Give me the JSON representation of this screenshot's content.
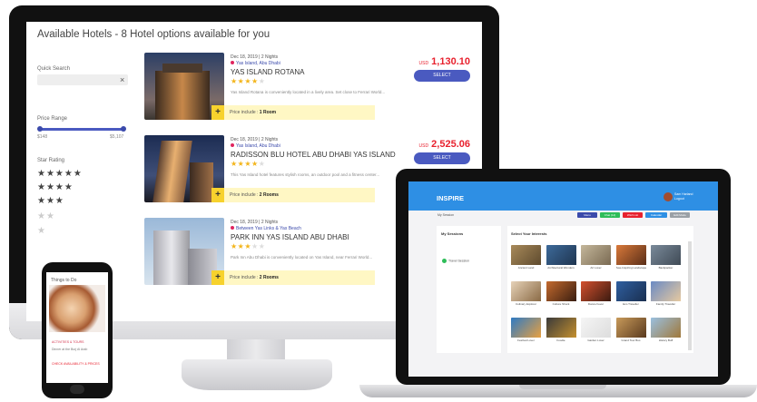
{
  "hotel_site": {
    "header": "Available Hotels - 8 Hotel options available for you",
    "filters": {
      "quick_search_label": "Quick Search",
      "clear_glyph": "×",
      "price_range_label": "Price Range",
      "price_min": "$148",
      "price_max": "$5,107",
      "star_rating_label": "Star Rating",
      "star_rows": [
        "★★★★★",
        "★★★★",
        "★★★",
        "★★",
        "★"
      ]
    },
    "hotels": [
      {
        "date": "Dec 18, 2019 | 2 Nights",
        "location": "Yas Island, Abu Dhabi",
        "name": "YAS ISLAND ROTANA",
        "stars": 4,
        "description": "Yas Island Rotana is conveniently located in a lively area. Set close to Ferrari World...",
        "price_currency": "USD",
        "price": "1,130.10",
        "select_label": "SELECT",
        "rooms_label": "Price include : ",
        "rooms_value": "1 Room",
        "plus_glyph": "+"
      },
      {
        "date": "Dec 18, 2019 | 2 Nights",
        "location": "Yas Island, Abu Dhabi",
        "name": "RADISSON BLU HOTEL ABU DHABI YAS ISLAND",
        "stars": 4,
        "description": "This Yas Island hotel features stylish rooms, an outdoor pool and a fitness center...",
        "price_currency": "USD",
        "price": "2,525.06",
        "select_label": "SELECT",
        "rooms_label": "Price include : ",
        "rooms_value": "2 Rooms",
        "plus_glyph": "+"
      },
      {
        "date": "Dec 18, 2019 | 2 Nights",
        "location": "Between Yas Links & Yas Beach",
        "name": "PARK INN YAS ISLAND ABU DHABI",
        "stars": 3,
        "description": "Park Inn Abu Dhabi is conveniently located on Yas Island, near Ferrari World...",
        "price_currency": "",
        "price": "",
        "select_label": "",
        "rooms_label": "Price include : ",
        "rooms_value": "2 Rooms",
        "plus_glyph": "+"
      }
    ]
  },
  "inspire_app": {
    "brand": "INSPIRE",
    "user_line1": "Sam Harland",
    "user_line2": "Logout",
    "breadcrumb": "My Session",
    "toolbar": [
      {
        "label": "Menu",
        "color": "#3b4aab"
      },
      {
        "label": "Chat (12)",
        "color": "#2ebd59"
      },
      {
        "label": "Wish List",
        "color": "#e8212e"
      },
      {
        "label": "Calendar",
        "color": "#2e8fe4"
      },
      {
        "label": "Edit Mode",
        "color": "#9aa0a6"
      }
    ],
    "sessions_title": "My Sessions",
    "session_item": "Travel Session",
    "interests_title": "Select Your Interests",
    "tiles": [
      {
        "label": "Ancient Land",
        "c1": "#a88a5a",
        "c2": "#5e4a2e"
      },
      {
        "label": "Architectural Wonders",
        "c1": "#3d6a9a",
        "c2": "#1f3550"
      },
      {
        "label": "Art Lover",
        "c1": "#c4b79b",
        "c2": "#7a6a52"
      },
      {
        "label": "Awe-Inspiring Landscapes",
        "c1": "#d9793a",
        "c2": "#5a2e18"
      },
      {
        "label": "Backpacker",
        "c1": "#7a8a9a",
        "c2": "#3f4a55"
      },
      {
        "label": "Culinary Explorer",
        "c1": "#e6d2b8",
        "c2": "#8a6a45"
      },
      {
        "label": "Culture Shock",
        "c1": "#c46a2e",
        "c2": "#3a1e10"
      },
      {
        "label": "Dance Fever",
        "c1": "#d4502e",
        "c2": "#3a1a10"
      },
      {
        "label": "Eco Traveller",
        "c1": "#2f5fa0",
        "c2": "#1a2f50"
      },
      {
        "label": "Family Traveller",
        "c1": "#6a8ac4",
        "c2": "#e6c9a0"
      },
      {
        "label": "Festival Lover",
        "c1": "#2e7ac4",
        "c2": "#e8a040"
      },
      {
        "label": "Foodie",
        "c1": "#3a3a3a",
        "c2": "#c4902e"
      },
      {
        "label": "Garden Lover",
        "c1": "#f5f5f5",
        "c2": "#dddddd"
      },
      {
        "label": "Grand Tour Bus",
        "c1": "#c89a5a",
        "c2": "#5a3a1e"
      },
      {
        "label": "History Buff",
        "c1": "#9ac0e0",
        "c2": "#a0783a"
      }
    ]
  },
  "phone_site": {
    "title": "Things to Do",
    "line1": "ACTIVITIES & TOURS",
    "line2": "Dinner at the Burj Al Arab",
    "line3": "CHECK AVAILABILITY & PRICES"
  },
  "colors": {
    "accent_blue": "#4a5ac0",
    "price_red": "#e8212e",
    "star_gold": "#f3b51b",
    "inspire_blue": "#2e8fe4"
  }
}
